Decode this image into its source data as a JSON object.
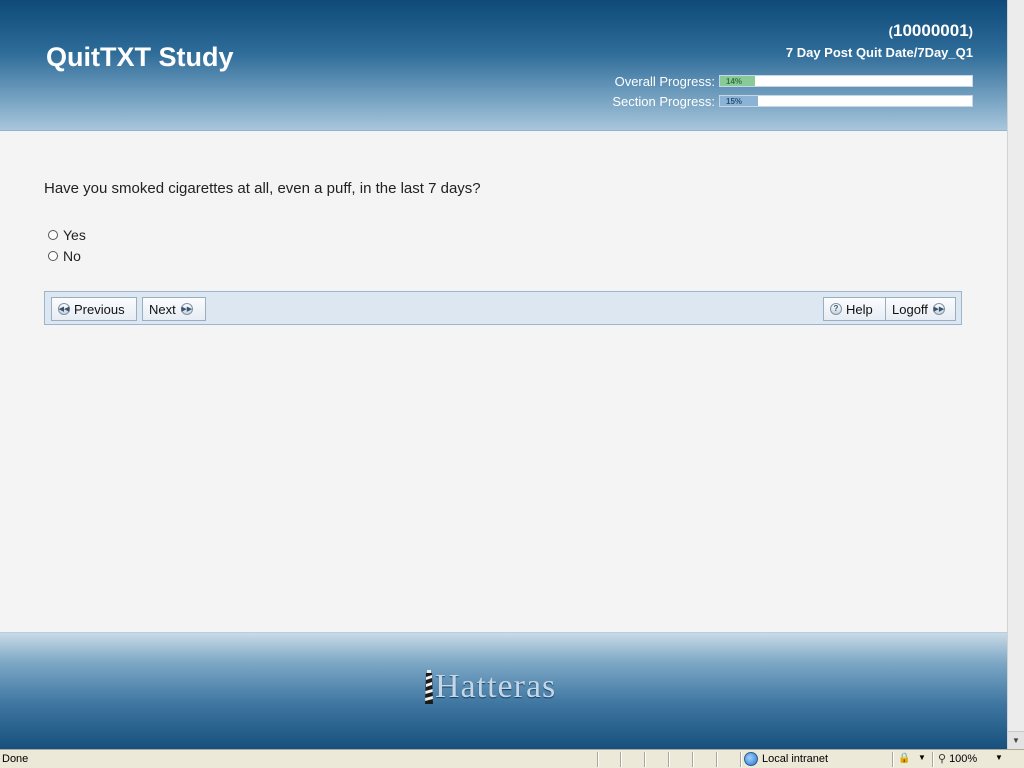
{
  "header": {
    "title": "QuitTXT Study",
    "participant_id": "10000001",
    "paren_open": "(",
    "paren_close": ")",
    "survey_path": "7 Day Post Quit Date/7Day_Q1",
    "overall_progress": {
      "label": "Overall Progress:",
      "percent_text": "14%",
      "value": 14
    },
    "section_progress": {
      "label": "Section Progress:",
      "percent_text": "15%",
      "value": 15
    }
  },
  "question": {
    "text": "Have you smoked cigarettes at all, even a puff, in the last 7 days?",
    "options": [
      "Yes",
      "No"
    ]
  },
  "nav": {
    "previous_label": "Previous",
    "next_label": "Next",
    "help_label": "Help",
    "logoff_label": "Logoff"
  },
  "footer": {
    "brand": "Hatteras"
  },
  "statusbar": {
    "status": "Done",
    "zone": "Local intranet",
    "zoom": "100%"
  },
  "icons": {
    "previous": "rewind-circle-icon",
    "next": "forward-circle-icon",
    "help": "question-circle-icon",
    "logoff": "forward-circle-icon",
    "footer": "lighthouse-icon",
    "zone": "globe-icon"
  },
  "colors": {
    "header_dark": "#0f4a78",
    "progress_overall": "#8ac99a",
    "progress_section": "#8db3d4",
    "navbar_bg": "#dde7f2"
  }
}
